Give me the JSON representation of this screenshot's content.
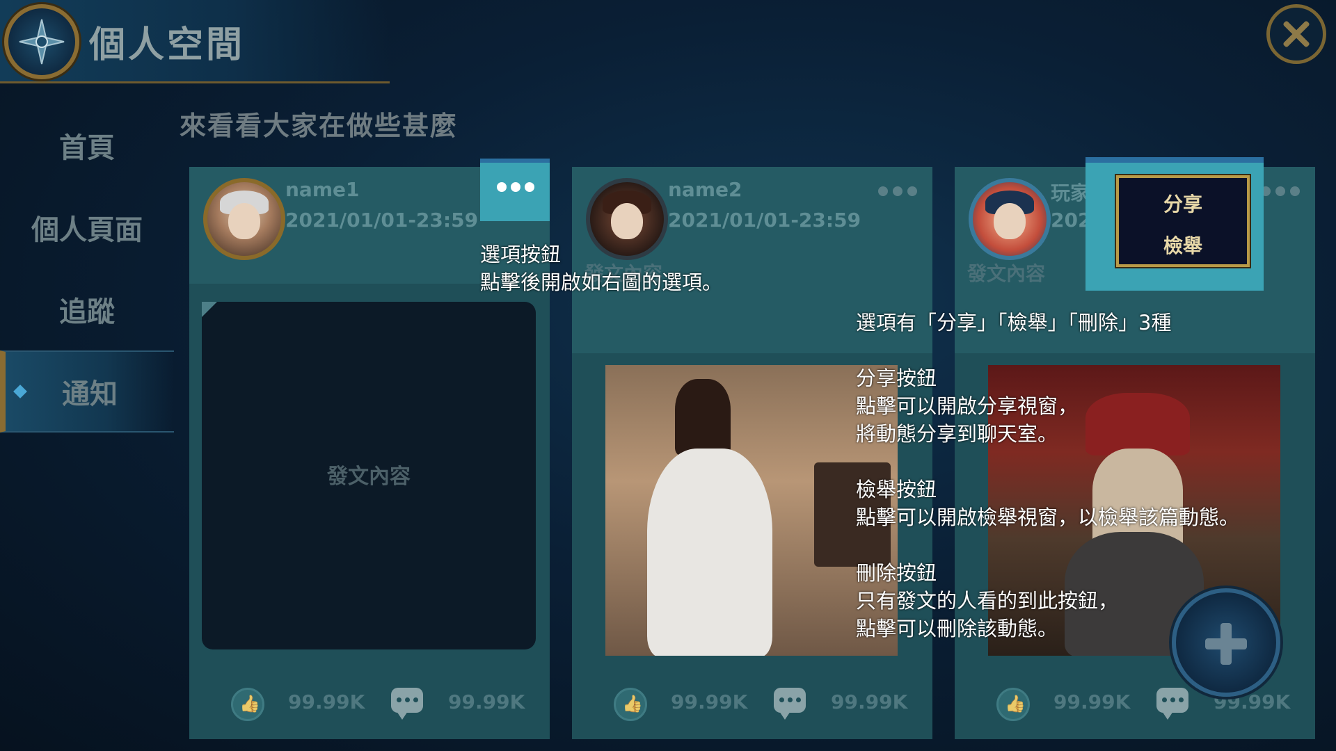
{
  "header": {
    "title": "個人空間"
  },
  "sidebar": {
    "items": [
      {
        "label": "首頁"
      },
      {
        "label": "個人頁面"
      },
      {
        "label": "追蹤"
      },
      {
        "label": "通知"
      }
    ]
  },
  "main": {
    "subtitle": "來看看大家在做些甚麼"
  },
  "cards": [
    {
      "name": "name1",
      "time": "2021/01/01-23:59",
      "content": "發文內容",
      "likes": "99.99K",
      "comments": "99.99K"
    },
    {
      "name": "name2",
      "time": "2021/01/01-23:59",
      "content": "發文內容",
      "likes": "99.99K",
      "comments": "99.99K"
    },
    {
      "name": "玩家名稱",
      "time": "2021/01/01-23:59",
      "content": "發文內容",
      "likes": "99.99K",
      "comments": "99.99K"
    }
  ],
  "popup": {
    "share": "分享",
    "report": "檢舉"
  },
  "annotations": {
    "more_button": "選項按鈕\n點擊後開啟如右圖的選項。",
    "options": "選項有「分享」「檢舉」「刪除」3種",
    "share": "分享按鈕\n點擊可以開啟分享視窗，\n將動態分享到聊天室。",
    "report": "檢舉按鈕\n點擊可以開啟檢舉視窗，以檢舉該篇動態。",
    "delete": "刪除按鈕\n只有發文的人看的到此按鈕，\n點擊可以刪除該動態。"
  },
  "icons": {
    "emblem": "compass-star-icon",
    "close": "close-icon",
    "more": "more-dots-icon",
    "like": "thumbs-up-icon",
    "comment": "comment-bubble-icon",
    "add": "plus-icon"
  },
  "colors": {
    "highlight": "#3ba3b4",
    "gold": "#b89a48",
    "panel": "#1f4f58"
  }
}
